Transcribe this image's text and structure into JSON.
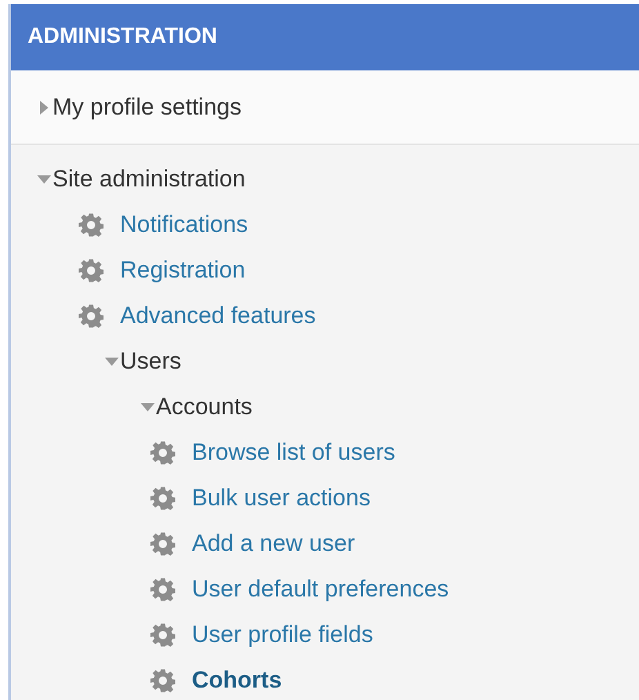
{
  "block": {
    "title": "ADMINISTRATION"
  },
  "tree": [
    {
      "label": "My profile settings",
      "kind": "branch",
      "expanded": false
    },
    {
      "label": "Site administration",
      "kind": "branch",
      "expanded": true,
      "children": [
        {
          "label": "Notifications",
          "kind": "leaf",
          "selected": false
        },
        {
          "label": "Registration",
          "kind": "leaf",
          "selected": false
        },
        {
          "label": "Advanced features",
          "kind": "leaf",
          "selected": false
        },
        {
          "label": "Users",
          "kind": "branch",
          "expanded": true,
          "children": [
            {
              "label": "Accounts",
              "kind": "branch",
              "expanded": true,
              "children": [
                {
                  "label": "Browse list of users",
                  "kind": "leaf",
                  "selected": false
                },
                {
                  "label": "Bulk user actions",
                  "kind": "leaf",
                  "selected": false
                },
                {
                  "label": "Add a new user",
                  "kind": "leaf",
                  "selected": false
                },
                {
                  "label": "User default preferences",
                  "kind": "leaf",
                  "selected": false
                },
                {
                  "label": "User profile fields",
                  "kind": "leaf",
                  "selected": false
                },
                {
                  "label": "Cohorts",
                  "kind": "leaf",
                  "selected": true
                }
              ]
            }
          ]
        }
      ]
    }
  ]
}
